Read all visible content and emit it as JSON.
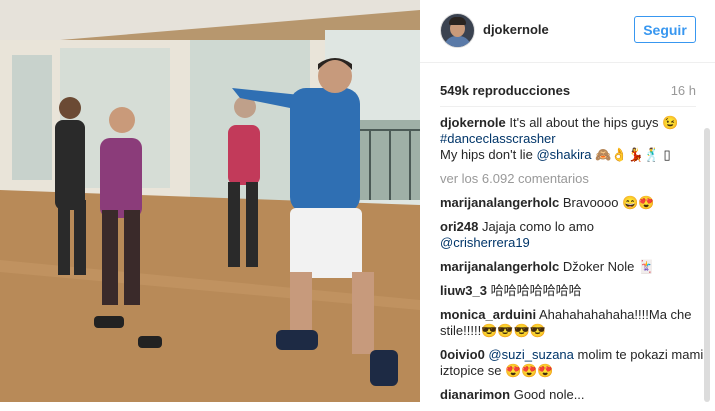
{
  "post": {
    "username": "djokernole",
    "follow_label": "Seguir",
    "views": "549k reproducciones",
    "time_ago": "16 h",
    "caption": {
      "username": "djokernole",
      "text1": "It's all about the hips guys 😉",
      "hashtag": "#danceclasscrasher",
      "text2": "My hips don't lie",
      "mention": "@shakira",
      "emojis": "🙈👌💃🕺 ▯"
    },
    "view_all_comments": "ver los 6.092 comentarios"
  },
  "comments": [
    {
      "username": "marijanalangerholc",
      "text": "Bravoooo 😄😍"
    },
    {
      "username": "ori248",
      "text": "Jajaja como lo amo",
      "mention": "@crisherrera19"
    },
    {
      "username": "marijanalangerholc",
      "text": "Džoker Nole 🃏"
    },
    {
      "username": "liuw3_3",
      "text": "哈哈哈哈哈哈哈"
    },
    {
      "username": "monica_arduini",
      "text": "Ahahahahahaha!!!!Ma che stile!!!!!😎😎😎😎"
    },
    {
      "username": "0oivio0",
      "mention": "@suzi_suzana",
      "text": "molim te pokazi mami iztopice se 😍😍😍"
    },
    {
      "username": "dianarimon",
      "text": "Good nole..."
    }
  ],
  "colors": {
    "accent": "#3897f0",
    "link": "#003569",
    "text": "#262626",
    "muted": "#999999"
  },
  "icons": {
    "video": "dance-class-video"
  }
}
